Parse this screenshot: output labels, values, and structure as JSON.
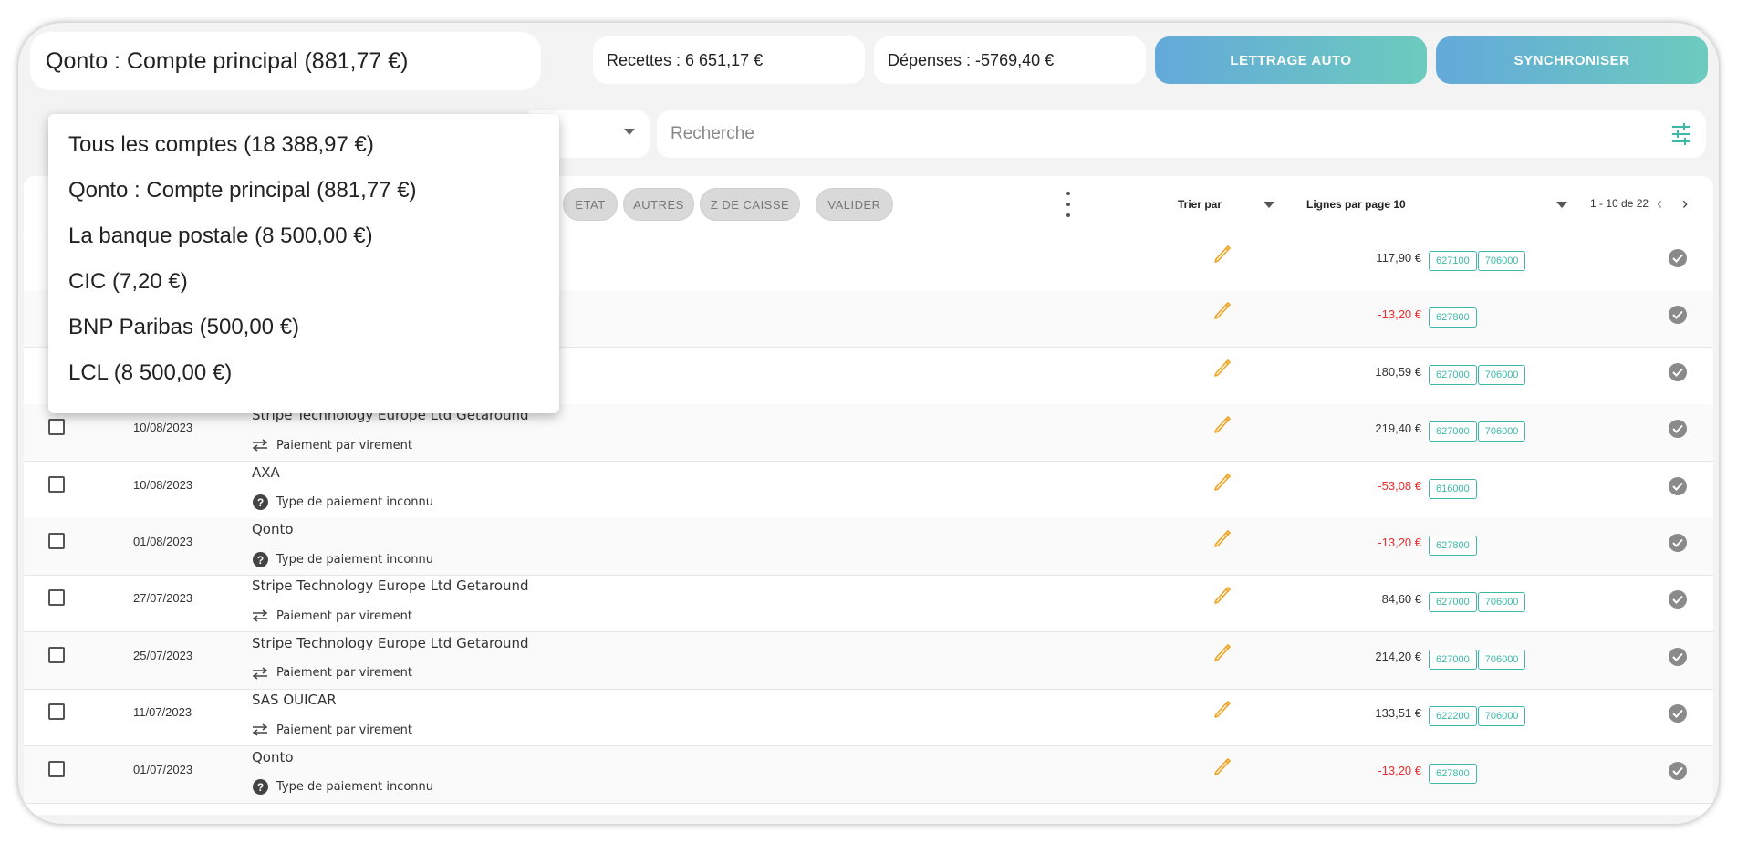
{
  "header": {
    "account_selected": "Qonto : Compte principal (881,77 €)",
    "recettes": "Recettes : 6 651,17 €",
    "depenses": "Dépenses : -5769,40 €",
    "lettrage_button": "LETTRAGE AUTO",
    "sync_button": "SYNCHRONISER"
  },
  "search": {
    "placeholder": "Recherche"
  },
  "account_dropdown": {
    "items": [
      "Tous les comptes (18 388,97 €)",
      "Qonto : Compte principal (881,77 €)",
      "La banque postale (8 500,00 €)",
      "CIC (7,20 €)",
      "BNP Paribas (500,00 €)",
      "LCL (8 500,00 €)"
    ]
  },
  "toolbar": {
    "chips": [
      "ETAT",
      "AUTRES",
      "Z DE CAISSE",
      "VALIDER"
    ],
    "sort_label": "Trier par",
    "rows_per_page": "Lignes par page 10",
    "pagination": "1 - 10 de 22"
  },
  "rows": [
    {
      "date": "",
      "label": "",
      "payment_type": "",
      "payment_icon": "",
      "amount": "117,90 €",
      "negative": false,
      "tags": [
        "627100",
        "706000"
      ]
    },
    {
      "date": "",
      "label": "",
      "payment_type": "",
      "payment_icon": "",
      "amount": "-13,20 €",
      "negative": true,
      "tags": [
        "627800"
      ]
    },
    {
      "date": "",
      "label": "",
      "payment_type": "",
      "payment_icon": "",
      "amount": "180,59 €",
      "negative": false,
      "tags": [
        "627000",
        "706000"
      ]
    },
    {
      "date": "10/08/2023",
      "label": "Stripe Technology Europe Ltd Getaround",
      "payment_type": "Paiement par virement",
      "payment_icon": "transfer-icon",
      "amount": "219,40 €",
      "negative": false,
      "tags": [
        "627000",
        "706000"
      ]
    },
    {
      "date": "10/08/2023",
      "label": "AXA",
      "payment_type": "Type de paiement inconnu",
      "payment_icon": "question-icon",
      "amount": "-53,08 €",
      "negative": true,
      "tags": [
        "616000"
      ]
    },
    {
      "date": "01/08/2023",
      "label": "Qonto",
      "payment_type": "Type de paiement inconnu",
      "payment_icon": "question-icon",
      "amount": "-13,20 €",
      "negative": true,
      "tags": [
        "627800"
      ]
    },
    {
      "date": "27/07/2023",
      "label": "Stripe Technology Europe Ltd Getaround",
      "payment_type": "Paiement par virement",
      "payment_icon": "transfer-icon",
      "amount": "84,60 €",
      "negative": false,
      "tags": [
        "627000",
        "706000"
      ]
    },
    {
      "date": "25/07/2023",
      "label": "Stripe Technology Europe Ltd Getaround",
      "payment_type": "Paiement par virement",
      "payment_icon": "transfer-icon",
      "amount": "214,20 €",
      "negative": false,
      "tags": [
        "627000",
        "706000"
      ]
    },
    {
      "date": "11/07/2023",
      "label": "SAS OUICAR",
      "payment_type": "Paiement par virement",
      "payment_icon": "transfer-icon",
      "amount": "133,51 €",
      "negative": false,
      "tags": [
        "622200",
        "706000"
      ]
    },
    {
      "date": "01/07/2023",
      "label": "Qonto",
      "payment_type": "Type de paiement inconnu",
      "payment_icon": "question-icon",
      "amount": "-13,20 €",
      "negative": true,
      "tags": [
        "627800"
      ]
    }
  ],
  "colors": {
    "accent_teal": "#3bb8a8",
    "gradient_start": "#63a9da",
    "gradient_end": "#6ccbbd",
    "negative_red": "#ee2a2a",
    "pencil_orange": "#f0a21f"
  }
}
